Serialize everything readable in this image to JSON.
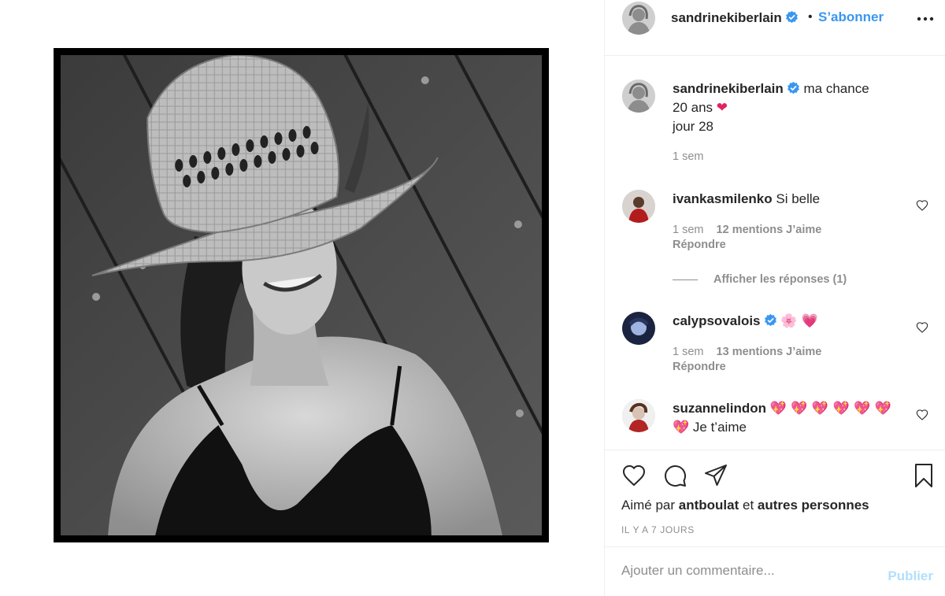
{
  "post": {
    "author": "sandrinekiberlain",
    "follow_label": "S’abonner",
    "separator": "•"
  },
  "caption": {
    "user": "sandrinekiberlain",
    "line1": "ma chance",
    "line2": "20 ans",
    "line2_emoji": "❤",
    "line3": "jour 28",
    "time": "1 sem"
  },
  "comments": [
    {
      "user": "ivankasmilenko",
      "text": "Si belle",
      "time": "1 sem",
      "likes": "12 mentions J’aime",
      "reply": "Répondre",
      "view_replies": "Afficher les réponses (1)"
    },
    {
      "user": "calypsovalois",
      "text": "🌸 💗",
      "time": "1 sem",
      "likes": "13 mentions J’aime",
      "reply": "Répondre"
    },
    {
      "user": "suzannelindon",
      "emojis_line1": "💖 💖 💖 💖 💖 💖",
      "emojis_line2_prefix": "💖",
      "text": "Je t’aime"
    }
  ],
  "actions": {
    "liked_by_prefix": "Aimé par",
    "liked_by_user": "antboulat",
    "liked_by_joiner": "et",
    "liked_by_others": "autres personnes",
    "date": "IL Y A 7 JOURS"
  },
  "add_comment": {
    "placeholder": "Ajouter un commentaire...",
    "publish_label": "Publier"
  },
  "colors": {
    "link_blue": "#3897f0",
    "publish_disabled": "#b2dffc",
    "muted": "#8e8e8e",
    "text": "#262626",
    "verified": "#3897f0"
  }
}
